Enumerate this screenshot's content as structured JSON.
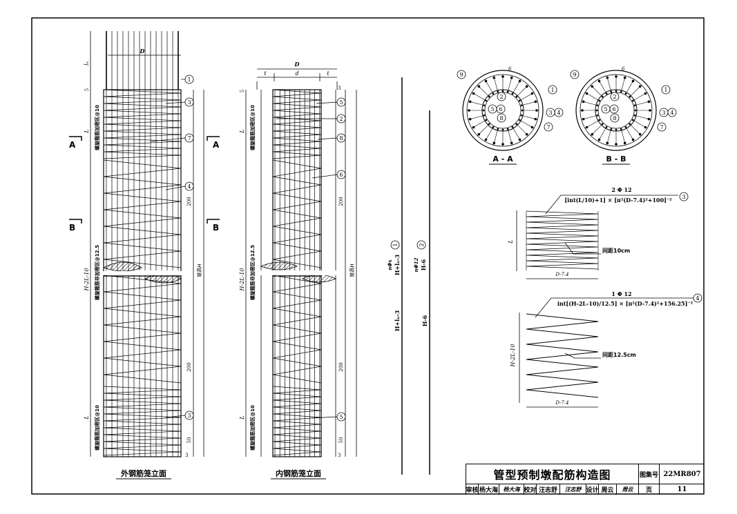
{
  "drawing": {
    "outer_cage": {
      "caption": "外钢筋笼立面",
      "dim_D": "D",
      "dim_ln": "lₙ",
      "dim_3": "3",
      "dim_5": "5",
      "dim_L_top": "L",
      "dim_mid": "H-2L-10",
      "dim_L_bot": "L",
      "dim_200_top": "200",
      "dim_200_bot": "200",
      "dim_50": "50",
      "dim_H": "墩高H",
      "label_top_zone": "螺旋箍筋加密区@10",
      "label_mid_zone": "螺旋箍筋非加密区@12.5",
      "label_bot_zone": "螺旋箍筋加密区@10",
      "callouts": [
        "1",
        "3",
        "7",
        "4",
        "3"
      ]
    },
    "inner_cage": {
      "caption": "内钢筋笼立面",
      "dim_D": "D",
      "dim_t": "t",
      "dim_d": "d",
      "dim_3": "3",
      "dim_5": "5",
      "dim_L_top": "L",
      "dim_mid": "H-2L-10",
      "dim_L_bot": "L",
      "dim_200_top": "200",
      "dim_200_bot": "200",
      "dim_50": "50",
      "dim_H": "墩高H",
      "label_top_zone": "螺旋箍筋加密区@10",
      "label_mid_zone": "螺旋箍筋非加密区@12.5",
      "label_bot_zone": "螺旋箍筋加密区@10",
      "callouts": [
        "5",
        "2",
        "8",
        "6",
        "5"
      ]
    },
    "section_marks": {
      "A": "A",
      "B": "B"
    },
    "bars": {
      "bar1_spec": "nΦx",
      "bar1_len": "H+lₙ-3",
      "bar1_no": "1",
      "bar1_total": "H+lₙ-3",
      "bar2_spec": "nΦ12",
      "bar2_len": "H-6",
      "bar2_no": "2",
      "bar2_total": "H-6"
    },
    "sections": {
      "aa_title": "A - A",
      "bb_title": "B - B",
      "callouts": [
        "9",
        "1",
        "2",
        "5",
        "6",
        "8",
        "3",
        "4",
        "7"
      ],
      "thickness": "6"
    },
    "spiral3": {
      "spec": "2 Φ 12",
      "formula": "[int(L/10)+1] × [π²(D-7.4)²+100]⁻²",
      "no": "3",
      "dim_L": "L",
      "pitch": "间距10cm",
      "width": "D-7.4"
    },
    "spiral4": {
      "spec": "1 Φ 12",
      "formula": "int[(H-2L-10)/12.5] × [π²(D-7.4)²+156.25]⁻²",
      "no": "4",
      "dim_H": "H-2L-10",
      "pitch": "间距12.5cm",
      "width": "D-7.4"
    }
  },
  "title_block": {
    "title": "管型预制墩配筋构造图",
    "atlas_label": "图集号",
    "atlas_no": "22MR807",
    "review_label": "审核",
    "reviewer": "杨大海",
    "reviewer_sig": "杨大海",
    "check_label": "校对",
    "checker": "汪志舒",
    "checker_sig": "汪志舒",
    "design_label": "设计",
    "designer": "周云",
    "designer_sig": "周云",
    "page_label": "页",
    "page_no": "11"
  }
}
